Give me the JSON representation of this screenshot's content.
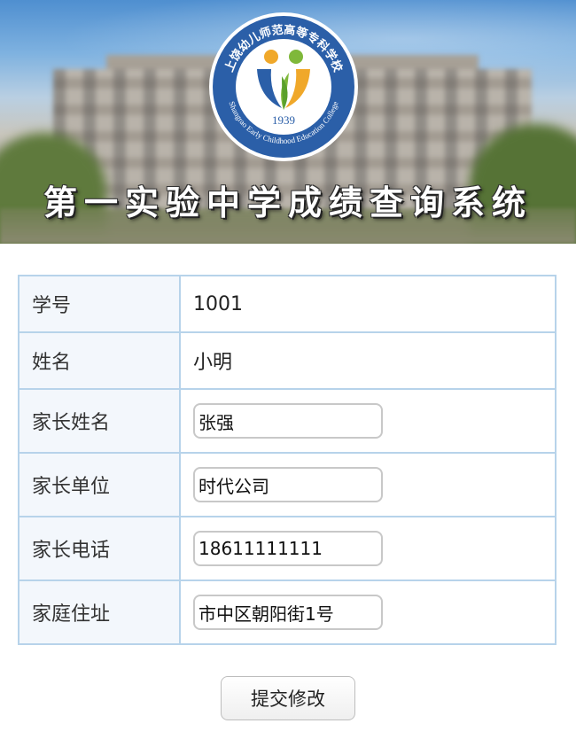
{
  "banner": {
    "title": "第一实验中学成绩查询系统",
    "logo": {
      "name_cn": "上饶幼儿师范高等专科学校",
      "name_en": "Shangrao Early Childhood Education College",
      "year": "1939"
    }
  },
  "form": {
    "rows": [
      {
        "label": "学号",
        "value": "1001"
      },
      {
        "label": "姓名",
        "value": "小明"
      },
      {
        "label": "家长姓名",
        "value": "张强"
      },
      {
        "label": "家长单位",
        "value": "时代公司"
      },
      {
        "label": "家长电话",
        "value": "18611111111"
      },
      {
        "label": "家庭住址",
        "value": "市中区朝阳街1号"
      }
    ]
  },
  "submit_label": "提交修改"
}
